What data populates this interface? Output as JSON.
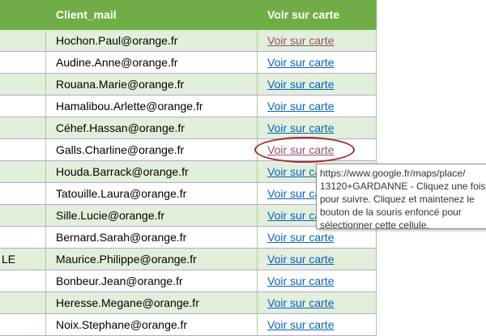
{
  "header": {
    "col_client_mail": "Client_mail",
    "col_map": "Voir sur carte"
  },
  "rows": [
    {
      "left": "",
      "email": "Hochon.Paul@orange.fr",
      "link": "Voir sur carte"
    },
    {
      "left": "",
      "email": "Audine.Anne@orange.fr",
      "link": "Voir sur carte"
    },
    {
      "left": "",
      "email": "Rouana.Marie@orange.fr",
      "link": "Voir sur carte"
    },
    {
      "left": "",
      "email": "Hamalibou.Arlette@orange.fr",
      "link": "Voir sur carte"
    },
    {
      "left": "",
      "email": "Céhef.Hassan@orange.fr",
      "link": "Voir sur carte"
    },
    {
      "left": "",
      "email": "Galls.Charline@orange.fr",
      "link": "Voir sur carte"
    },
    {
      "left": "",
      "email": "Houda.Barrack@orange.fr",
      "link": "Voir sur carte"
    },
    {
      "left": "",
      "email": "Tatouille.Laura@orange.fr",
      "link": "Voir sur carte"
    },
    {
      "left": "",
      "email": "Sille.Lucie@orange.fr",
      "link": "Voir sur carte"
    },
    {
      "left": "",
      "email": "Bernard.Sarah@orange.fr",
      "link": "Voir sur carte"
    },
    {
      "left": "LE",
      "email": "Maurice.Philippe@orange.fr",
      "link": "Voir sur carte"
    },
    {
      "left": "",
      "email": "Bonbeur.Jean@orange.fr",
      "link": "Voir sur carte"
    },
    {
      "left": "",
      "email": "Heresse.Megane@orange.fr",
      "link": "Voir sur carte"
    },
    {
      "left": "",
      "email": "Noix.Stephane@orange.fr",
      "link": "Voir sur carte"
    }
  ],
  "tooltip": {
    "lines": [
      "https://www.google.fr/maps/place/",
      "13120+GARDANNE - Cliquez une fois",
      "pour suivre. Cliquez et maintenez le",
      "bouton de la souris enfoncé pour",
      "sélectionner cette cellule."
    ]
  },
  "colors": {
    "header_bg": "#70ad47",
    "band_green": "#e2efda",
    "link": "#0563c1",
    "link_visited": "#954f72",
    "highlight_oval": "#a12c2c"
  }
}
